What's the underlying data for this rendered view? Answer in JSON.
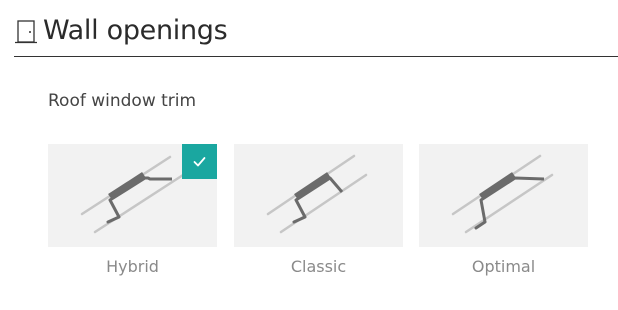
{
  "section": {
    "title": "Wall openings",
    "icon": "door-icon"
  },
  "roof_window_trim": {
    "label": "Roof window trim",
    "selected": "Hybrid",
    "accent_color": "#1aa7a0",
    "options": [
      {
        "label": "Hybrid",
        "icon": "trim-profile-hybrid-icon",
        "selected": true
      },
      {
        "label": "Classic",
        "icon": "trim-profile-classic-icon",
        "selected": false
      },
      {
        "label": "Optimal",
        "icon": "trim-profile-optimal-icon",
        "selected": false
      }
    ]
  }
}
